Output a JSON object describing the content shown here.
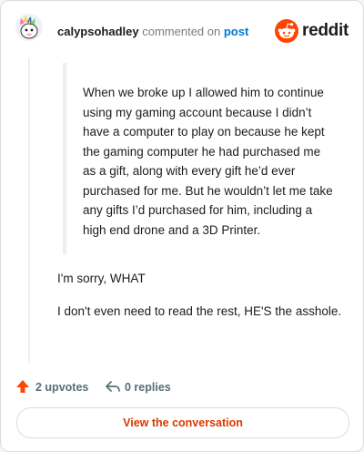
{
  "header": {
    "username": "calypsohadley",
    "action_text": "commented on",
    "link_text": "post",
    "brand_name": "reddit",
    "brand_color": "#ff4500",
    "avatar_icon": "user-avatar-unicorn",
    "logo_icon": "reddit-snoo-logo"
  },
  "comment": {
    "quote": "When we broke up I allowed him to continue using my gaming account because I didn’t have a computer to play on because he kept the gaming computer he had purchased me as a gift, along with every gift he’d ever purchased for me. But he wouldn’t let me take any gifts I’d purchased for him, including a high end drone and a 3D Printer.",
    "paragraphs": [
      "I'm sorry, WHAT",
      "I don't even need to read the rest, HE'S the asshole."
    ]
  },
  "actions": {
    "upvotes": "2 upvotes",
    "replies": "0 replies",
    "upvote_icon": "upvote-arrow-icon",
    "reply_icon": "reply-arrow-icon",
    "upvote_color": "#ff4500"
  },
  "cta": {
    "label": "View the conversation"
  }
}
